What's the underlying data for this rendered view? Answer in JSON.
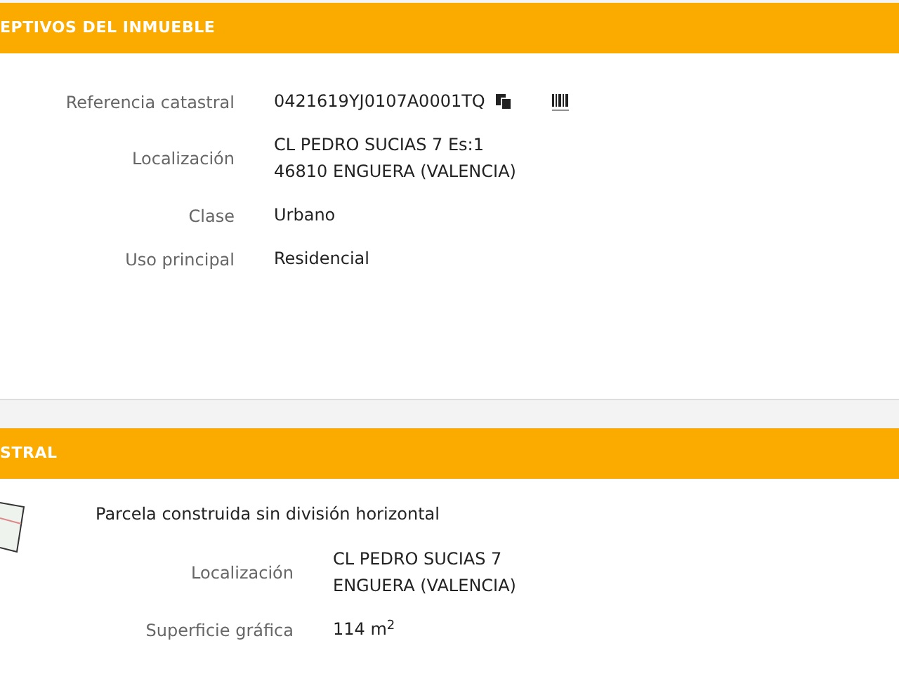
{
  "sections": [
    {
      "title": "EPTIVOS DEL INMUEBLE",
      "rows": [
        {
          "label": "Referencia catastral",
          "lines": [
            "0421619YJ0107A0001TQ"
          ],
          "kind": "reference"
        },
        {
          "label": "Localización",
          "lines": [
            "CL PEDRO SUCIAS 7 Es:1",
            "46810 ENGUERA (VALENCIA)"
          ],
          "kind": "text"
        },
        {
          "label": "Clase",
          "lines": [
            "Urbano"
          ],
          "kind": "text"
        },
        {
          "label": "Uso principal",
          "lines": [
            "Residencial"
          ],
          "kind": "text"
        }
      ]
    },
    {
      "title": "STRAL",
      "subtitle": "Parcela construida sin división horizontal",
      "rows": [
        {
          "label": "Localización",
          "lines": [
            "CL PEDRO SUCIAS 7",
            "ENGUERA (VALENCIA)"
          ],
          "kind": "text"
        },
        {
          "label": "Superficie gráfica",
          "lines": [
            "114 m$^{2}$"
          ],
          "kind": "text"
        }
      ]
    }
  ]
}
